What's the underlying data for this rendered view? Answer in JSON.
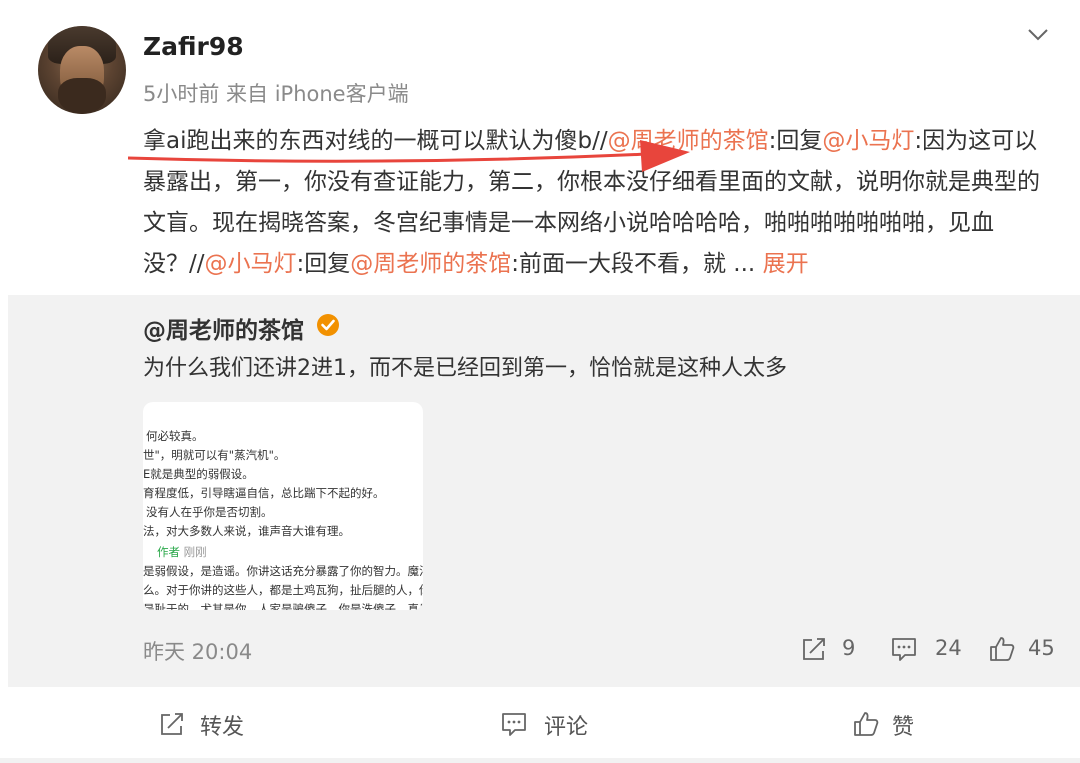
{
  "post": {
    "username": "Zafir98",
    "meta": "5小时前 来自 iPhone客户端",
    "text": {
      "seg1": "拿ai跑出来的东西对线的一概可以默认为傻b//",
      "mention1": "@周老师的茶馆",
      "seg2": ":回复",
      "mention2": "@小马灯",
      "seg3": ":因为这可以暴露出，第一，你没有查证能力，第二，你根本没仔细看里面的文献，说明你就是典型的文盲。现在揭晓答案，冬宫纪事情是一本网络小说哈哈哈哈，啪啪啪啪啪啪啪，见血没？//",
      "mention3": "@小马灯",
      "seg4": ":回复",
      "mention4": "@周老师的茶馆",
      "seg5": ":前面一大段不看，就 ... ",
      "expand": "展开"
    }
  },
  "quoted": {
    "username": "@周老师的茶馆",
    "text": "为什么我们还讲2进1，而不是已经回到第一，恰恰就是这种人太多",
    "image_lines": {
      "l1": "何必较真。",
      "l2": "世\"，明就可以有\"蒸汽机\"。",
      "l3": "E就是典型的弱假设。",
      "l4": "育程度低，引导瞎逼自信，总比踹下不起的好。",
      "l5": "没有人在乎你是否切割。",
      "l6": "法，对大多数人来说，谁声音大谁有理。",
      "author_tag": "作者",
      "author_time": "刚刚",
      "l7": "是弱假设，是造谣。你讲这话充分暴露了你的智力。魔法对",
      "l8": "么。对于你讲的这些人，都是土鸡瓦狗，扯后腿的人，你厨",
      "l9": "是耻于的。尤其是你，人家是骗傻子，你是洗傻子，真是底"
    },
    "time": "昨天 20:04",
    "reposts": "9",
    "comments": "24",
    "likes": "45"
  },
  "actions": {
    "repost": "转发",
    "comment": "评论",
    "like": "赞"
  },
  "colors": {
    "mention": "#eb7350",
    "arrow": "#e8453c",
    "verified": "#f29100"
  }
}
